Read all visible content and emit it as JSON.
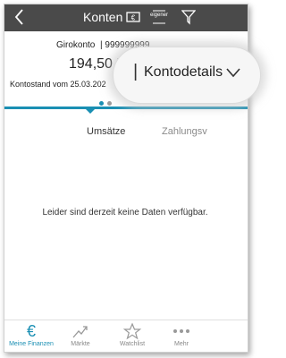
{
  "header": {
    "title": "Konten",
    "sort_icon_label": "eigener",
    "back_icon": "chevron-left-icon",
    "money_icon": "banknote-icon",
    "filter_icon": "filter-icon"
  },
  "account": {
    "name": "Girokonto",
    "number": "| 999999999",
    "balance": "194,50 E",
    "stand": "Kontostand vom 25.03.202",
    "carousel_dots": 2,
    "carousel_active": 0
  },
  "tabs": [
    {
      "label": "Umsätze"
    },
    {
      "label": "Zahlungsv"
    }
  ],
  "empty_message": "Leider sind derzeit keine Daten verfügbar.",
  "zoom_overlay": {
    "label": "Kontodetails",
    "fragment": "| "
  },
  "bottom_nav": [
    {
      "label": "Meine Finanzen",
      "icon": "euro-icon",
      "active": true
    },
    {
      "label": "Märkte",
      "icon": "trend-chart-icon",
      "active": false
    },
    {
      "label": "Watchlist",
      "icon": "star-icon",
      "active": false
    },
    {
      "label": "Mehr",
      "icon": "more-dots-icon",
      "active": false
    }
  ],
  "colors": {
    "header": "#4a4a4a",
    "accent": "#1a8fb3"
  }
}
